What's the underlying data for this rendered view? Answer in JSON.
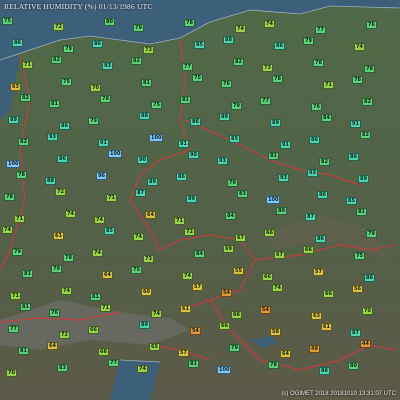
{
  "title": "RELATIVE HUMIDITY (%) 01/13/1986 UTC",
  "credit": "(c) OGIMET 2018 20181010 13:31:07 UTC",
  "colors": {
    "water": "#3c5f7a",
    "land_north": "#4f6a48",
    "land_south": "#5a5a4a",
    "border": "#d03a3a",
    "coast": "#9ab0c4"
  },
  "stations": [
    {
      "v": "75"
    },
    {
      "v": "72"
    },
    {
      "v": "80"
    },
    {
      "v": "79"
    },
    {
      "v": "78"
    },
    {
      "v": "74"
    },
    {
      "v": "74"
    },
    {
      "v": "77"
    },
    {
      "v": "76"
    },
    {
      "v": "86"
    },
    {
      "v": "79"
    },
    {
      "v": "86"
    },
    {
      "v": "73"
    },
    {
      "v": "85"
    },
    {
      "v": "88"
    },
    {
      "v": "86"
    },
    {
      "v": "79"
    },
    {
      "v": "74"
    },
    {
      "v": "71"
    },
    {
      "v": "82"
    },
    {
      "v": "93"
    },
    {
      "v": "82"
    },
    {
      "v": "77"
    },
    {
      "v": "82"
    },
    {
      "v": "73"
    },
    {
      "v": "78"
    },
    {
      "v": "78"
    },
    {
      "v": "63"
    },
    {
      "v": "75"
    },
    {
      "v": "70"
    },
    {
      "v": "81"
    },
    {
      "v": "75"
    },
    {
      "v": "76"
    },
    {
      "v": "78"
    },
    {
      "v": "71"
    },
    {
      "v": "78"
    },
    {
      "v": "82"
    },
    {
      "v": "81"
    },
    {
      "v": "78"
    },
    {
      "v": "75"
    },
    {
      "v": "81"
    },
    {
      "v": "79"
    },
    {
      "v": "77"
    },
    {
      "v": "76"
    },
    {
      "v": "82"
    },
    {
      "v": "89"
    },
    {
      "v": "86"
    },
    {
      "v": "79"
    },
    {
      "v": "88"
    },
    {
      "v": "86"
    },
    {
      "v": "89"
    },
    {
      "v": "89"
    },
    {
      "v": "84"
    },
    {
      "v": "91"
    },
    {
      "v": "82"
    },
    {
      "v": "93"
    },
    {
      "v": "91"
    },
    {
      "v": "100"
    },
    {
      "v": "91"
    },
    {
      "v": "85"
    },
    {
      "v": "91"
    },
    {
      "v": "86"
    },
    {
      "v": "82"
    },
    {
      "v": "100"
    },
    {
      "v": "86"
    },
    {
      "v": "100"
    },
    {
      "v": "90"
    },
    {
      "v": "90"
    },
    {
      "v": "93"
    },
    {
      "v": "81"
    },
    {
      "v": "82"
    },
    {
      "v": "86"
    },
    {
      "v": "78"
    },
    {
      "v": "88"
    },
    {
      "v": "96"
    },
    {
      "v": "89"
    },
    {
      "v": "86"
    },
    {
      "v": "79"
    },
    {
      "v": "93"
    },
    {
      "v": "93"
    },
    {
      "v": "89"
    },
    {
      "v": "78"
    },
    {
      "v": "72"
    },
    {
      "v": "71"
    },
    {
      "v": "87"
    },
    {
      "v": "89"
    },
    {
      "v": "83"
    },
    {
      "v": "100"
    },
    {
      "v": "86"
    },
    {
      "v": "85"
    },
    {
      "v": "71"
    },
    {
      "v": "74"
    },
    {
      "v": "74"
    },
    {
      "v": "64"
    },
    {
      "v": "71"
    },
    {
      "v": "84"
    },
    {
      "v": "80"
    },
    {
      "v": "87"
    },
    {
      "v": "81"
    },
    {
      "v": "74"
    },
    {
      "v": "61"
    },
    {
      "v": "85"
    },
    {
      "v": "74"
    },
    {
      "v": "72"
    },
    {
      "v": "67"
    },
    {
      "v": "66"
    },
    {
      "v": "86"
    },
    {
      "v": "79"
    },
    {
      "v": "79"
    },
    {
      "v": "78"
    },
    {
      "v": "74"
    },
    {
      "v": "73"
    },
    {
      "v": "84"
    },
    {
      "v": "69"
    },
    {
      "v": "67"
    },
    {
      "v": "66"
    },
    {
      "v": "75"
    },
    {
      "v": "81"
    },
    {
      "v": "79"
    },
    {
      "v": "64"
    },
    {
      "v": "75"
    },
    {
      "v": "74"
    },
    {
      "v": "55"
    },
    {
      "v": "66"
    },
    {
      "v": "57"
    },
    {
      "v": "86"
    },
    {
      "v": "71"
    },
    {
      "v": "74"
    },
    {
      "v": "81"
    },
    {
      "v": "60"
    },
    {
      "v": "57"
    },
    {
      "v": "54"
    },
    {
      "v": "74"
    },
    {
      "v": "66"
    },
    {
      "v": "56"
    },
    {
      "v": "81"
    },
    {
      "v": "76"
    },
    {
      "v": "71"
    },
    {
      "v": "74"
    },
    {
      "v": "61"
    },
    {
      "v": "66"
    },
    {
      "v": "54"
    },
    {
      "v": "63"
    },
    {
      "v": "70"
    },
    {
      "v": "77"
    },
    {
      "v": "72"
    },
    {
      "v": "66"
    },
    {
      "v": "89"
    },
    {
      "v": "54"
    },
    {
      "v": "66"
    },
    {
      "v": "58"
    },
    {
      "v": "61"
    },
    {
      "v": "87"
    },
    {
      "v": "81"
    },
    {
      "v": "64"
    },
    {
      "v": "66"
    },
    {
      "v": "65"
    },
    {
      "v": "57"
    },
    {
      "v": "79"
    },
    {
      "v": "64"
    },
    {
      "v": "49"
    },
    {
      "v": "44"
    },
    {
      "v": "70"
    },
    {
      "v": "83"
    },
    {
      "v": "77"
    },
    {
      "v": "74"
    },
    {
      "v": "81"
    },
    {
      "v": "100"
    },
    {
      "v": "78"
    },
    {
      "v": "86"
    },
    {
      "v": "80"
    }
  ]
}
